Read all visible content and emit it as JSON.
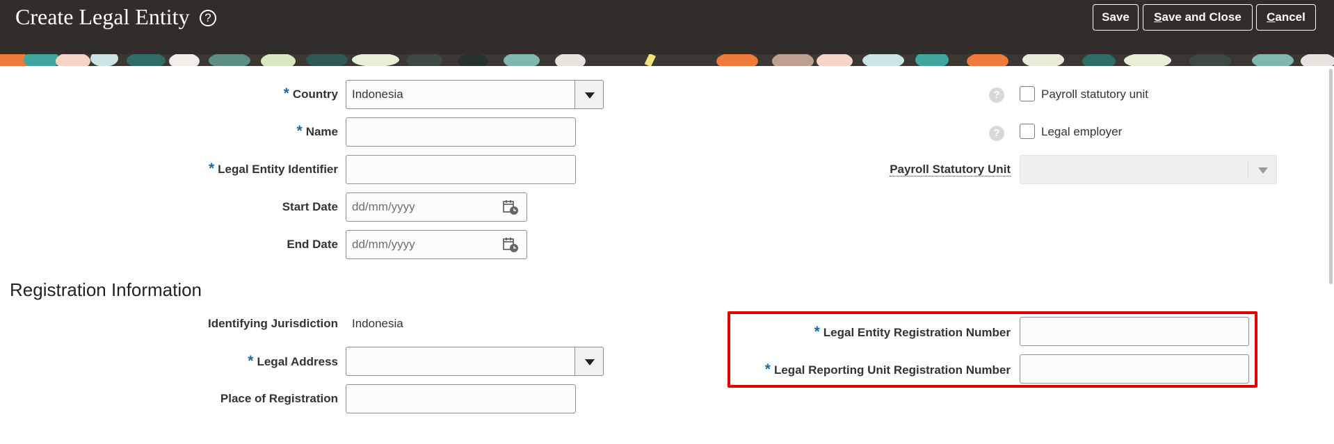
{
  "header": {
    "title": "Create Legal Entity",
    "help_glyph": "?",
    "save": "Save",
    "save_and_close_underlined": "S",
    "save_and_close_rest": "ave and Close",
    "cancel_underlined": "C",
    "cancel_rest": "ancel"
  },
  "required_marker": "*",
  "form": {
    "country": {
      "label": "Country",
      "value": "Indonesia"
    },
    "name": {
      "label": "Name",
      "value": ""
    },
    "legal_entity_identifier": {
      "label": "Legal Entity Identifier",
      "value": ""
    },
    "start_date": {
      "label": "Start Date",
      "placeholder": "dd/mm/yyyy"
    },
    "end_date": {
      "label": "End Date",
      "placeholder": "dd/mm/yyyy"
    },
    "payroll_statutory_unit_checkbox": {
      "label": "Payroll statutory unit",
      "checked": false
    },
    "legal_employer_checkbox": {
      "label": "Legal employer",
      "checked": false
    },
    "payroll_statutory_unit_select": {
      "label": "Payroll Statutory Unit",
      "value": ""
    }
  },
  "registration": {
    "section_title": "Registration Information",
    "identifying_jurisdiction": {
      "label": "Identifying Jurisdiction",
      "value": "Indonesia"
    },
    "legal_address": {
      "label": "Legal Address",
      "value": ""
    },
    "place_of_registration": {
      "label": "Place of Registration",
      "value": ""
    },
    "legal_entity_registration_number": {
      "label": "Legal Entity Registration Number",
      "value": ""
    },
    "legal_reporting_unit_registration_number": {
      "label": "Legal Reporting Unit Registration Number",
      "value": ""
    }
  },
  "icons": {
    "help": "help-icon",
    "calendar": "calendar-icon",
    "dropdown": "chevron-down-icon",
    "field_help": "question-icon"
  },
  "colors": {
    "header_bg": "#312d2a",
    "required": "#1c6aa6",
    "highlight_border": "#e00000"
  }
}
